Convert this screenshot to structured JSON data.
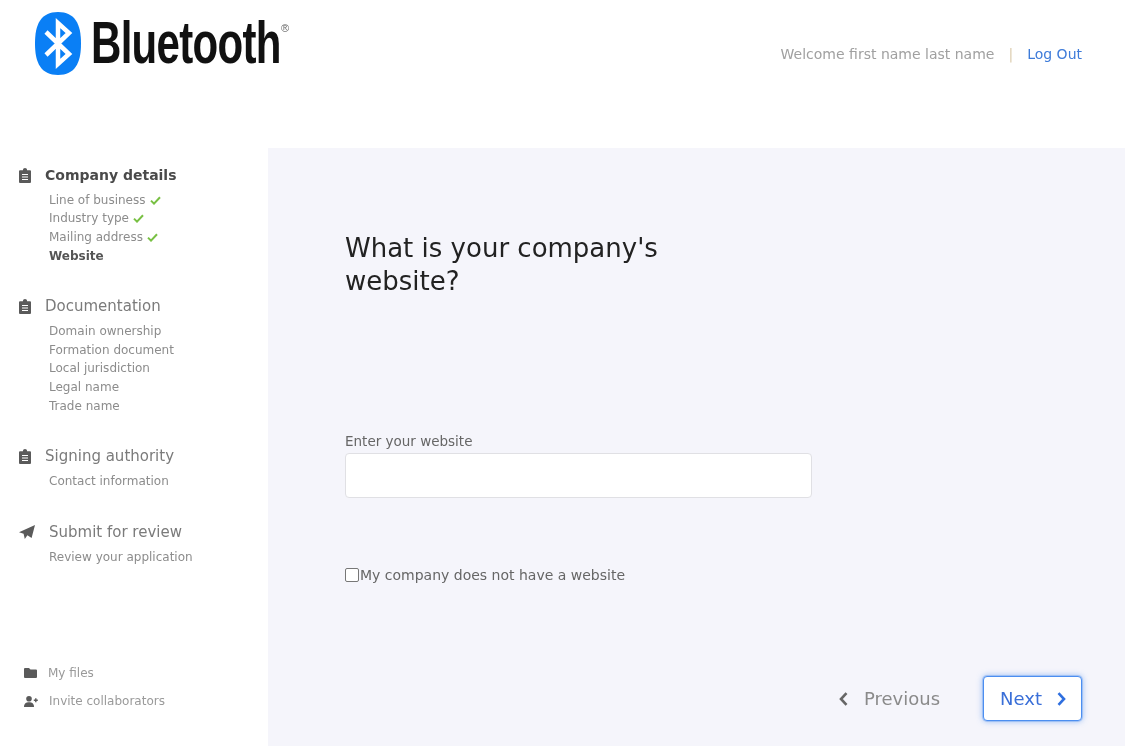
{
  "header": {
    "logo": {
      "name": "Bluetooth",
      "registered_mark": "®"
    },
    "welcome": "Welcome first name last name",
    "separator": "|",
    "logout": "Log Out"
  },
  "sidebar": {
    "sections": [
      {
        "kind": "section",
        "title": "Company details",
        "selected": true,
        "steps": [
          {
            "label": "Line of business",
            "done": true,
            "selected": false
          },
          {
            "label": "Industry type",
            "done": true,
            "selected": false
          },
          {
            "label": "Mailing address",
            "done": true,
            "selected": false
          },
          {
            "label": "Website",
            "done": false,
            "selected": true
          }
        ]
      },
      {
        "kind": "section",
        "title": "Documentation",
        "selected": false,
        "steps": [
          {
            "label": "Domain ownership",
            "done": false,
            "selected": false
          },
          {
            "label": "Formation document",
            "done": false,
            "selected": false
          },
          {
            "label": "Local jurisdiction",
            "done": false,
            "selected": false
          },
          {
            "label": "Legal name",
            "done": false,
            "selected": false
          },
          {
            "label": "Trade name",
            "done": false,
            "selected": false
          }
        ]
      },
      {
        "kind": "section",
        "title": "Signing authority",
        "selected": false,
        "steps": [
          {
            "label": "Contact information",
            "done": false,
            "selected": false
          }
        ]
      },
      {
        "kind": "submit",
        "title": "Submit for review",
        "selected": false,
        "steps": [
          {
            "label": "Review your application",
            "done": false,
            "selected": false
          }
        ]
      }
    ],
    "links": [
      {
        "kind": "files",
        "label": "My files"
      },
      {
        "kind": "invite",
        "label": "Invite collaborators"
      }
    ]
  },
  "main": {
    "question": "What is your company's website?",
    "field": {
      "label": "Enter your website"
    },
    "checkbox": {
      "label": "My company does not have a website",
      "checked": false
    },
    "buttons": [
      {
        "kind": "back",
        "label": "Previous",
        "focused": false
      },
      {
        "kind": "forward",
        "label": "Next",
        "focused": true
      }
    ]
  }
}
